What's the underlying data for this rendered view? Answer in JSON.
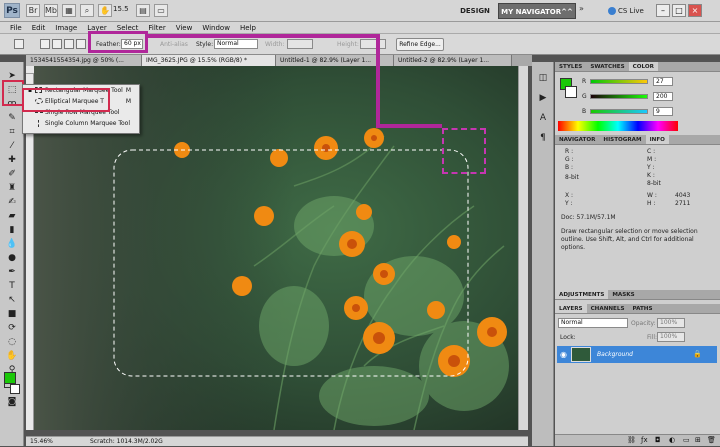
{
  "app": {
    "logo": "Ps",
    "zoom": "15.5",
    "workspace_design": "DESIGN",
    "workspace_active": "MY NAVIGATOR^^",
    "workspace_more": "»",
    "cs_live": "CS Live",
    "win_min": "–",
    "win_max": "□",
    "win_close": "×"
  },
  "menu": [
    "File",
    "Edit",
    "Image",
    "Layer",
    "Select",
    "Filter",
    "View",
    "Window",
    "Help"
  ],
  "options": {
    "feather_label": "Feather:",
    "feather_value": "60 px",
    "antialias_label": "Anti-alias",
    "style_label": "Style:",
    "style_value": "Normal",
    "width_label": "Width:",
    "height_label": "Height:",
    "refine_label": "Refine Edge..."
  },
  "tabs": [
    "1534541554354.jpg @ 50% (...",
    "IMG_3625.JPG @ 15.5% (RGB/8) *",
    "Untitled-1 @ 82.9% (Layer 1...",
    "Untitled-2 @ 82.9% (Layer 1..."
  ],
  "flyout": [
    {
      "label": "Rectangular Marquee Tool",
      "key": "M"
    },
    {
      "label": "Elliptical Marquee T",
      "key": "M"
    },
    {
      "label": "Single Row Marquee Tool",
      "key": ""
    },
    {
      "label": "Single Column Marquee Tool",
      "key": ""
    }
  ],
  "status": {
    "zoom": "15.46%",
    "scratch": "Scratch: 1014.3M/2.02G"
  },
  "panels": {
    "color_tabs": [
      "STYLES",
      "SWATCHES",
      "COLOR"
    ],
    "color": {
      "r_label": "R",
      "g_label": "G",
      "b_label": "B",
      "r": "27",
      "g": "200",
      "b": "9",
      "fg": "#1bc809",
      "bg": "#ffffff"
    },
    "info_tabs": [
      "NAVIGATOR",
      "HISTOGRAM",
      "INFO"
    ],
    "info": {
      "r": "R :",
      "g": "G :",
      "b": "B :",
      "c": "C :",
      "m": "M :",
      "y": "Y :",
      "k": "K :",
      "bit1": "8-bit",
      "bit2": "8-bit",
      "x": "X :",
      "yy": "Y :",
      "w": "W :",
      "h": "H :",
      "w_val": "4043",
      "h_val": "2711",
      "doc": "Doc: 57.1M/57.1M",
      "hint": "Draw rectangular selection or move selection outline. Use Shift, Alt, and Ctrl for additional options."
    },
    "adj_tabs": [
      "ADJUSTMENTS",
      "MASKS"
    ],
    "layer_tabs": [
      "LAYERS",
      "CHANNELS",
      "PATHS"
    ],
    "layers": {
      "blend": "Normal",
      "opacity_label": "Opacity:",
      "opacity": "100%",
      "lock_label": "Lock:",
      "fill_label": "Fill:",
      "fill": "100%",
      "layer_name": "Background"
    }
  }
}
